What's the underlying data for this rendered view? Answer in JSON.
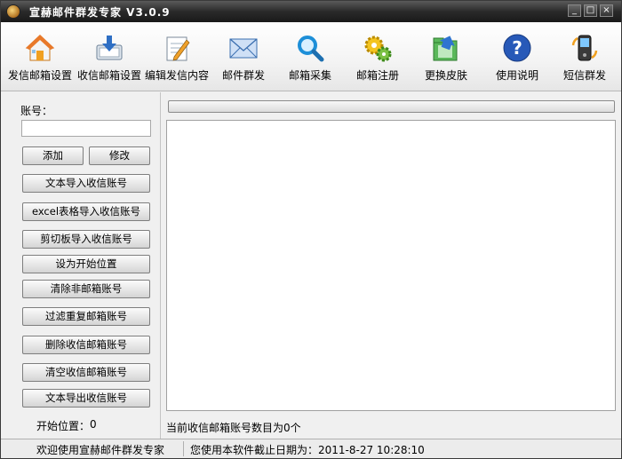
{
  "window": {
    "title": "宣赫邮件群发专家  V3.0.9",
    "minimize": "_",
    "maximize": "□",
    "close": "×"
  },
  "toolbar": {
    "items": [
      {
        "label": "发信邮箱设置",
        "icon": "house-icon"
      },
      {
        "label": "收信邮箱设置",
        "icon": "inbox-download-icon"
      },
      {
        "label": "编辑发信内容",
        "icon": "edit-note-icon"
      },
      {
        "label": "邮件群发",
        "icon": "envelope-icon"
      },
      {
        "label": "邮箱采集",
        "icon": "magnifier-icon"
      },
      {
        "label": "邮箱注册",
        "icon": "gears-icon"
      },
      {
        "label": "更换皮肤",
        "icon": "skin-folder-icon"
      },
      {
        "label": "使用说明",
        "icon": "help-icon"
      },
      {
        "label": "短信群发",
        "icon": "mobile-phone-icon"
      }
    ]
  },
  "left": {
    "account_label": "账号：",
    "account_value": "",
    "add": "添加",
    "modify": "修改",
    "buttons": [
      "文本导入收信账号",
      "excel表格导入收信账号",
      "剪切板导入收信账号",
      "设为开始位置",
      "清除非邮箱账号",
      "过滤重复邮箱账号",
      "删除收信邮箱账号",
      "清空收信邮箱账号",
      "文本导出收信账号"
    ],
    "start_position_label": "开始位置：",
    "start_position_value": "0"
  },
  "right": {
    "progress": 0,
    "count_text": "当前收信邮箱账号数目为0个"
  },
  "status": {
    "welcome": "欢迎使用宣赫邮件群发专家",
    "expire": "您使用本软件截止日期为：2011-8-27 10:28:10"
  },
  "colors": {
    "titlebar": "#2a2a2a",
    "accent": "#3aa83a"
  }
}
